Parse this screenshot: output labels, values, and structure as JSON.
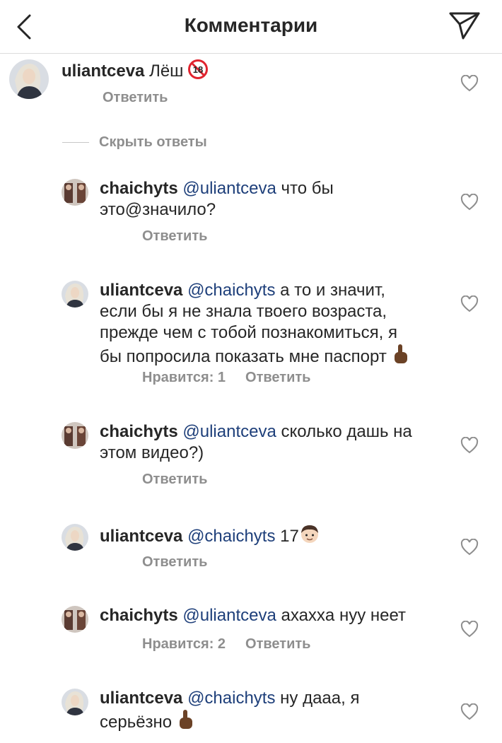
{
  "header": {
    "title": "Комментарии"
  },
  "hide_replies": "Скрыть ответы",
  "comments": [
    {
      "user": "uliantceva",
      "mention": "",
      "text": "Лёш",
      "badge_text": "18",
      "likes": "",
      "reply": "Ответить"
    },
    {
      "user": "chaichyts",
      "mention": "@uliantceva",
      "text": "что бы",
      "text2": "это@значило?",
      "likes": "",
      "reply": "Ответить"
    },
    {
      "user": "uliantceva",
      "mention": "@chaichyts",
      "text": "а то и значит,",
      "text2": "если бы я не знала твоего возраста,",
      "text3": "прежде чем с тобой познакомиться, я",
      "text4": "бы попросила показать мне паспорт",
      "likes": "Нравится: 1",
      "reply": "Ответить"
    },
    {
      "user": "chaichyts",
      "mention": "@uliantceva",
      "text": "сколько дашь на",
      "text2": "этом видео?)",
      "likes": "",
      "reply": "Ответить"
    },
    {
      "user": "uliantceva",
      "mention": "@chaichyts",
      "text": "17",
      "likes": "",
      "reply": "Ответить"
    },
    {
      "user": "chaichyts",
      "mention": "@uliantceva",
      "text": "ахаxxa нуу неет",
      "likes": "Нравится: 2",
      "reply": "Ответить"
    },
    {
      "user": "uliantceva",
      "mention": "@chaichyts",
      "text": "ну дааа, я",
      "text2": "серьёзно",
      "likes": "",
      "reply": ""
    }
  ],
  "icons": {
    "back": "chevron-left-icon",
    "send": "paper-plane-icon",
    "like": "heart-outline-icon",
    "finger_emoji": "index-pointing-up-emoji",
    "boy_emoji": "boy-emoji",
    "age_badge": "no-one-under-18-emoji"
  },
  "colors": {
    "text": "#262626",
    "secondary": "#8e8e8e",
    "mention": "#1e3f7a",
    "divider": "#dbdbdb"
  }
}
